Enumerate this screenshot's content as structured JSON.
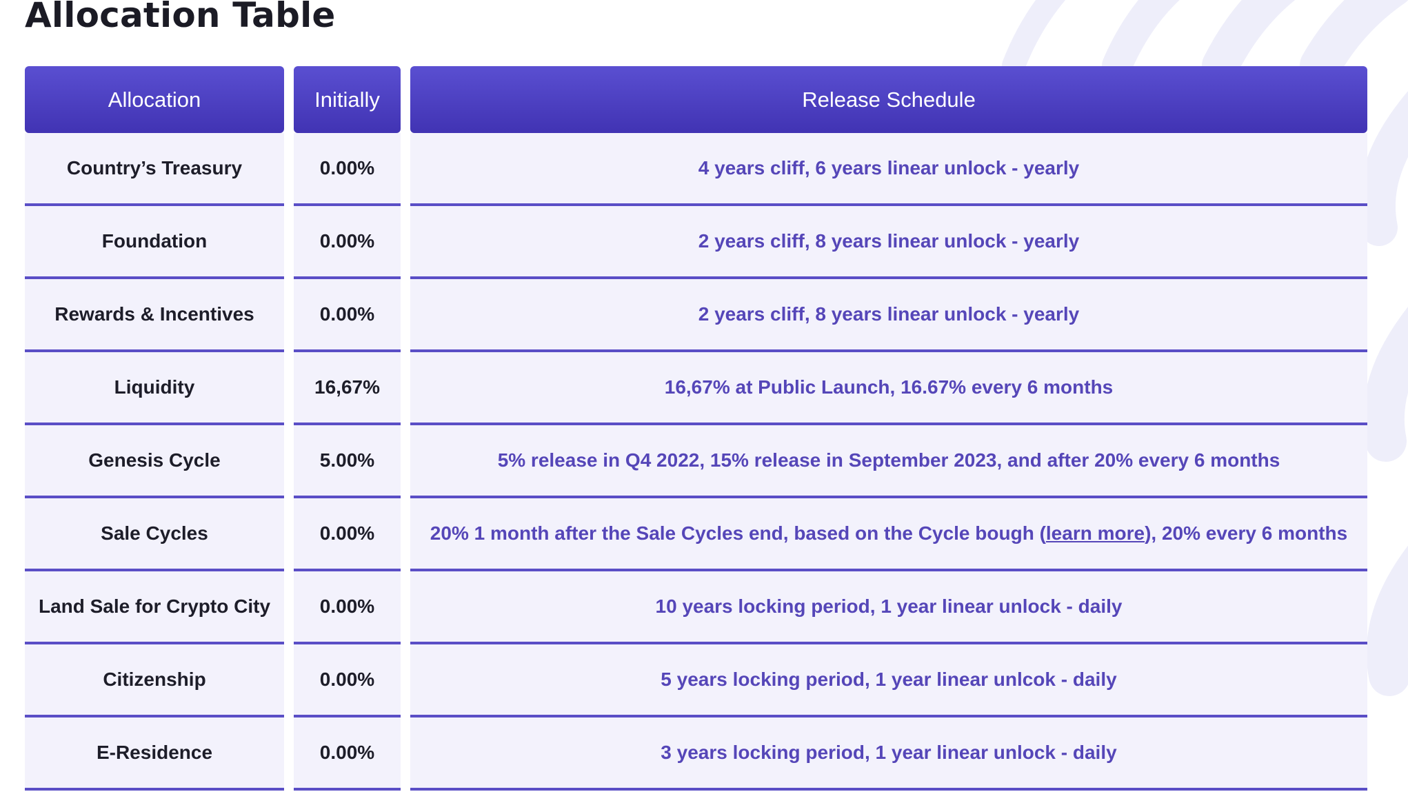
{
  "page": {
    "title": "Allocation Table"
  },
  "table": {
    "headers": {
      "allocation": "Allocation",
      "initially": "Initially",
      "release_schedule": "Release Schedule"
    },
    "rows": [
      {
        "allocation": "Country’s Treasury",
        "initially": "0.00%",
        "release": "4 years cliff, 6 years linear unlock - yearly"
      },
      {
        "allocation": "Foundation",
        "initially": "0.00%",
        "release": "2 years cliff, 8 years linear unlock - yearly"
      },
      {
        "allocation": "Rewards & Incentives",
        "initially": "0.00%",
        "release": "2 years cliff, 8 years linear unlock - yearly"
      },
      {
        "allocation": "Liquidity",
        "initially": "16,67%",
        "release": "16,67% at Public Launch, 16.67% every 6 months"
      },
      {
        "allocation": "Genesis Cycle",
        "initially": "5.00%",
        "release": "5% release in Q4 2022, 15% release in September 2023, and after 20% every 6 months"
      },
      {
        "allocation": "Sale Cycles",
        "initially": "0.00%",
        "release_before": "20% 1 month after the Sale Cycles end, based on the Cycle bough (",
        "release_link": "learn more",
        "release_after": "), 20% every 6 months"
      },
      {
        "allocation": "Land Sale for Crypto City",
        "initially": "0.00%",
        "release": "10 years locking period, 1 year linear unlock - daily"
      },
      {
        "allocation": "Citizenship",
        "initially": "0.00%",
        "release": "5 years locking period, 1 year linear unlcok - daily"
      },
      {
        "allocation": "E-Residence",
        "initially": "0.00%",
        "release": "3 years locking period, 1 year linear unlock - daily"
      }
    ]
  },
  "colors": {
    "header_bg": "#4d42c4",
    "cell_bg": "#f3f2fc",
    "row_border": "#5a4ec6",
    "release_text": "#5546b8",
    "dark_text": "#1d1d29",
    "decor_stripes": "#eeeefa"
  }
}
